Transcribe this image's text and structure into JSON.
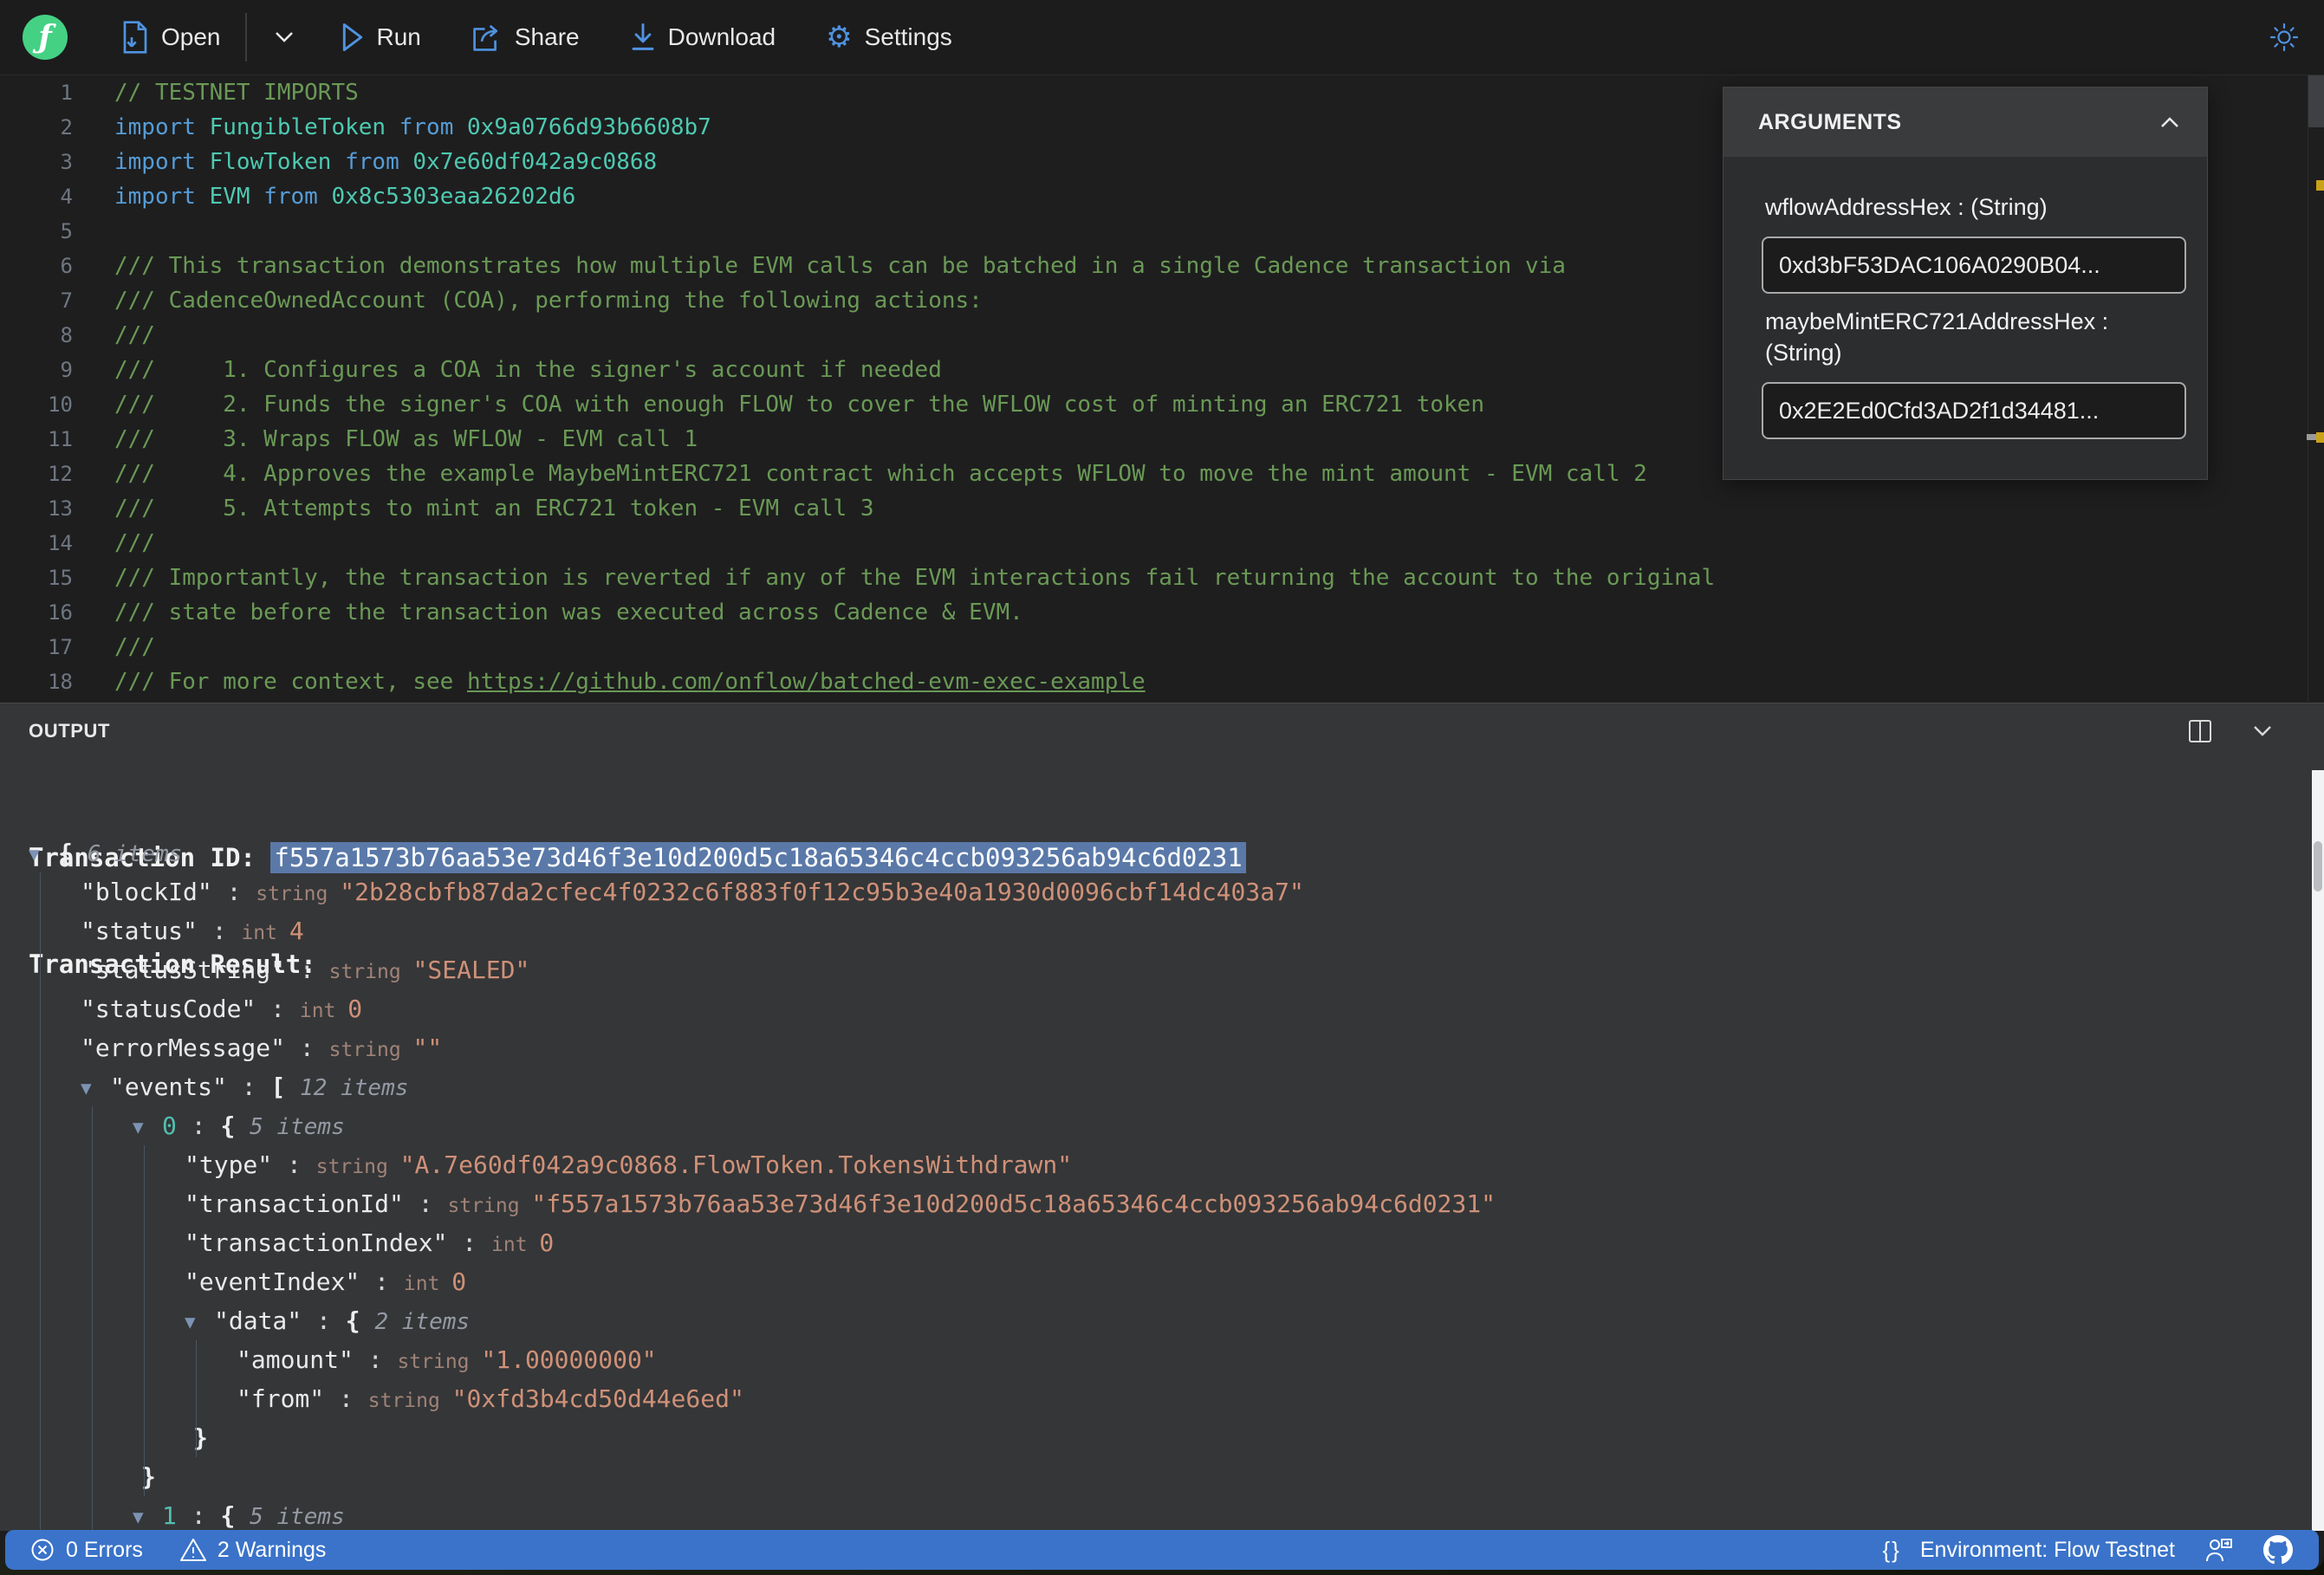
{
  "toolbar": {
    "open_label": "Open",
    "run_label": "Run",
    "share_label": "Share",
    "download_label": "Download",
    "settings_label": "Settings",
    "logo_glyph": "ƒ"
  },
  "arguments_panel": {
    "title": "ARGUMENTS",
    "args": [
      {
        "label": "wflowAddressHex : (String)",
        "value": "0xd3bF53DAC106A0290B04..."
      },
      {
        "label": "maybeMintERC721AddressHex : (String)",
        "value": "0x2E2Ed0Cfd3AD2f1d34481..."
      }
    ]
  },
  "editor": {
    "lines": [
      {
        "num": "1",
        "segs": [
          [
            "cm",
            "// TESTNET IMPORTS"
          ]
        ]
      },
      {
        "num": "2",
        "segs": [
          [
            "kw",
            "import "
          ],
          [
            "ty",
            "FungibleToken "
          ],
          [
            "kw",
            "from "
          ],
          [
            "ty",
            "0x9a0766d93b6608b7"
          ]
        ]
      },
      {
        "num": "3",
        "segs": [
          [
            "kw",
            "import "
          ],
          [
            "ty",
            "FlowToken "
          ],
          [
            "kw",
            "from "
          ],
          [
            "ty",
            "0x7e60df042a9c0868"
          ]
        ]
      },
      {
        "num": "4",
        "segs": [
          [
            "kw",
            "import "
          ],
          [
            "ty",
            "EVM "
          ],
          [
            "kw",
            "from "
          ],
          [
            "ty",
            "0x8c5303eaa26202d6"
          ]
        ]
      },
      {
        "num": "5",
        "segs": []
      },
      {
        "num": "6",
        "segs": [
          [
            "cm",
            "/// This transaction demonstrates how multiple EVM calls can be batched in a single Cadence transaction via"
          ]
        ]
      },
      {
        "num": "7",
        "segs": [
          [
            "cm",
            "/// CadenceOwnedAccount (COA), performing the following actions:"
          ]
        ]
      },
      {
        "num": "8",
        "segs": [
          [
            "cm",
            "///"
          ]
        ]
      },
      {
        "num": "9",
        "segs": [
          [
            "cm",
            "///     1. Configures a COA in the signer's account if needed"
          ]
        ]
      },
      {
        "num": "10",
        "segs": [
          [
            "cm",
            "///     2. Funds the signer's COA with enough FLOW to cover the WFLOW cost of minting an ERC721 token"
          ]
        ]
      },
      {
        "num": "11",
        "segs": [
          [
            "cm",
            "///     3. Wraps FLOW as WFLOW - EVM call 1"
          ]
        ]
      },
      {
        "num": "12",
        "segs": [
          [
            "cm",
            "///     4. Approves the example MaybeMintERC721 contract which accepts WFLOW to move the mint amount - EVM call 2"
          ]
        ]
      },
      {
        "num": "13",
        "segs": [
          [
            "cm",
            "///     5. Attempts to mint an ERC721 token - EVM call 3"
          ]
        ]
      },
      {
        "num": "14",
        "segs": [
          [
            "cm",
            "///"
          ]
        ]
      },
      {
        "num": "15",
        "segs": [
          [
            "cm",
            "/// Importantly, the transaction is reverted if any of the EVM interactions fail returning the account to the original"
          ]
        ]
      },
      {
        "num": "16",
        "segs": [
          [
            "cm",
            "/// state before the transaction was executed across Cadence & EVM."
          ]
        ]
      },
      {
        "num": "17",
        "segs": [
          [
            "cm",
            "///"
          ]
        ]
      },
      {
        "num": "18",
        "segs": [
          [
            "cm",
            "/// For more context, see "
          ],
          [
            "cm-link",
            "https://github.com/onflow/batched-evm-exec-example"
          ]
        ]
      }
    ]
  },
  "output": {
    "panel_title": "OUTPUT",
    "transaction_id_label": "Transaction ID: ",
    "transaction_id": "f557a1573b76aa53e73d46f3e10d200d5c18a65346c4ccb093256ab94c6d0231",
    "transaction_result_label": "Transaction Result:",
    "tree": {
      "rows": [
        {
          "ind": 0,
          "segs": [
            [
              "ar",
              "▼"
            ],
            [
              "br",
              "{ "
            ],
            [
              "it",
              "6 items"
            ]
          ]
        },
        {
          "ind": 1,
          "segs": [
            [
              "k",
              "\"blockId\""
            ],
            [
              "co",
              " : "
            ],
            [
              "ty",
              "string "
            ],
            [
              "s",
              "\"2b28cbfb87da2cfec4f0232c6f883f0f12c95b3e40a1930d0096cbf14dc403a7\""
            ]
          ]
        },
        {
          "ind": 1,
          "segs": [
            [
              "k",
              "\"status\""
            ],
            [
              "co",
              " : "
            ],
            [
              "ty",
              "int "
            ],
            [
              "n",
              "4"
            ]
          ]
        },
        {
          "ind": 1,
          "segs": [
            [
              "k",
              "\"statusString\""
            ],
            [
              "co",
              " : "
            ],
            [
              "ty",
              "string "
            ],
            [
              "s",
              "\"SEALED\""
            ]
          ]
        },
        {
          "ind": 1,
          "segs": [
            [
              "k",
              "\"statusCode\""
            ],
            [
              "co",
              " : "
            ],
            [
              "ty",
              "int "
            ],
            [
              "n",
              "0"
            ]
          ]
        },
        {
          "ind": 1,
          "segs": [
            [
              "k",
              "\"errorMessage\""
            ],
            [
              "co",
              " : "
            ],
            [
              "ty",
              "string "
            ],
            [
              "s",
              "\"\""
            ]
          ]
        },
        {
          "ind": 1,
          "segs": [
            [
              "ar",
              "▼"
            ],
            [
              "k",
              "\"events\""
            ],
            [
              "co",
              " : "
            ],
            [
              "br",
              "[ "
            ],
            [
              "it",
              "12 items"
            ]
          ]
        },
        {
          "ind": 2,
          "segs": [
            [
              "ar",
              "▼"
            ],
            [
              "ix",
              "0"
            ],
            [
              "co",
              " : "
            ],
            [
              "br",
              "{ "
            ],
            [
              "it",
              "5 items"
            ]
          ]
        },
        {
          "ind": 3,
          "segs": [
            [
              "k",
              "\"type\""
            ],
            [
              "co",
              " : "
            ],
            [
              "ty",
              "string "
            ],
            [
              "s",
              "\"A.7e60df042a9c0868.FlowToken.TokensWithdrawn\""
            ]
          ]
        },
        {
          "ind": 3,
          "segs": [
            [
              "k",
              "\"transactionId\""
            ],
            [
              "co",
              " : "
            ],
            [
              "ty",
              "string "
            ],
            [
              "s",
              "\"f557a1573b76aa53e73d46f3e10d200d5c18a65346c4ccb093256ab94c6d0231\""
            ]
          ]
        },
        {
          "ind": 3,
          "segs": [
            [
              "k",
              "\"transactionIndex\""
            ],
            [
              "co",
              " : "
            ],
            [
              "ty",
              "int "
            ],
            [
              "n",
              "0"
            ]
          ]
        },
        {
          "ind": 3,
          "segs": [
            [
              "k",
              "\"eventIndex\""
            ],
            [
              "co",
              " : "
            ],
            [
              "ty",
              "int "
            ],
            [
              "n",
              "0"
            ]
          ]
        },
        {
          "ind": 3,
          "segs": [
            [
              "ar",
              "▼"
            ],
            [
              "k",
              "\"data\""
            ],
            [
              "co",
              " : "
            ],
            [
              "br",
              "{ "
            ],
            [
              "it",
              "2 items"
            ]
          ]
        },
        {
          "ind": 4,
          "segs": [
            [
              "k",
              "\"amount\""
            ],
            [
              "co",
              " : "
            ],
            [
              "ty",
              "string "
            ],
            [
              "s",
              "\"1.00000000\""
            ]
          ]
        },
        {
          "ind": 4,
          "segs": [
            [
              "k",
              "\"from\""
            ],
            [
              "co",
              " : "
            ],
            [
              "ty",
              "string "
            ],
            [
              "s",
              "\"0xfd3b4cd50d44e6ed\""
            ]
          ]
        },
        {
          "ind": 3,
          "close": true,
          "segs": [
            [
              "br",
              "}"
            ]
          ]
        },
        {
          "ind": 2,
          "close": true,
          "segs": [
            [
              "br",
              "}"
            ]
          ]
        },
        {
          "ind": 2,
          "segs": [
            [
              "ar",
              "▼"
            ],
            [
              "ix",
              "1"
            ],
            [
              "co",
              " : "
            ],
            [
              "br",
              "{ "
            ],
            [
              "it",
              "5 items"
            ]
          ]
        },
        {
          "ind": 3,
          "partial": true,
          "copyOf": 8
        }
      ]
    }
  },
  "statusbar": {
    "errors_label": "0 Errors",
    "warnings_label": "2 Warnings",
    "braces_glyph": "{}",
    "environment_label": "Environment: Flow Testnet"
  },
  "colors": {
    "flow_green": "#45d184",
    "toolbar_icon_blue": "#4f93e0",
    "status_bar_blue": "#3a73c9",
    "warning_yellow": "#caa21a",
    "comment_green": "#6a9955",
    "keyword_blue": "#569cd6",
    "type_teal": "#4ec9b0",
    "string_salmon": "#cf9178",
    "selection_highlight": "#5a79a8"
  }
}
